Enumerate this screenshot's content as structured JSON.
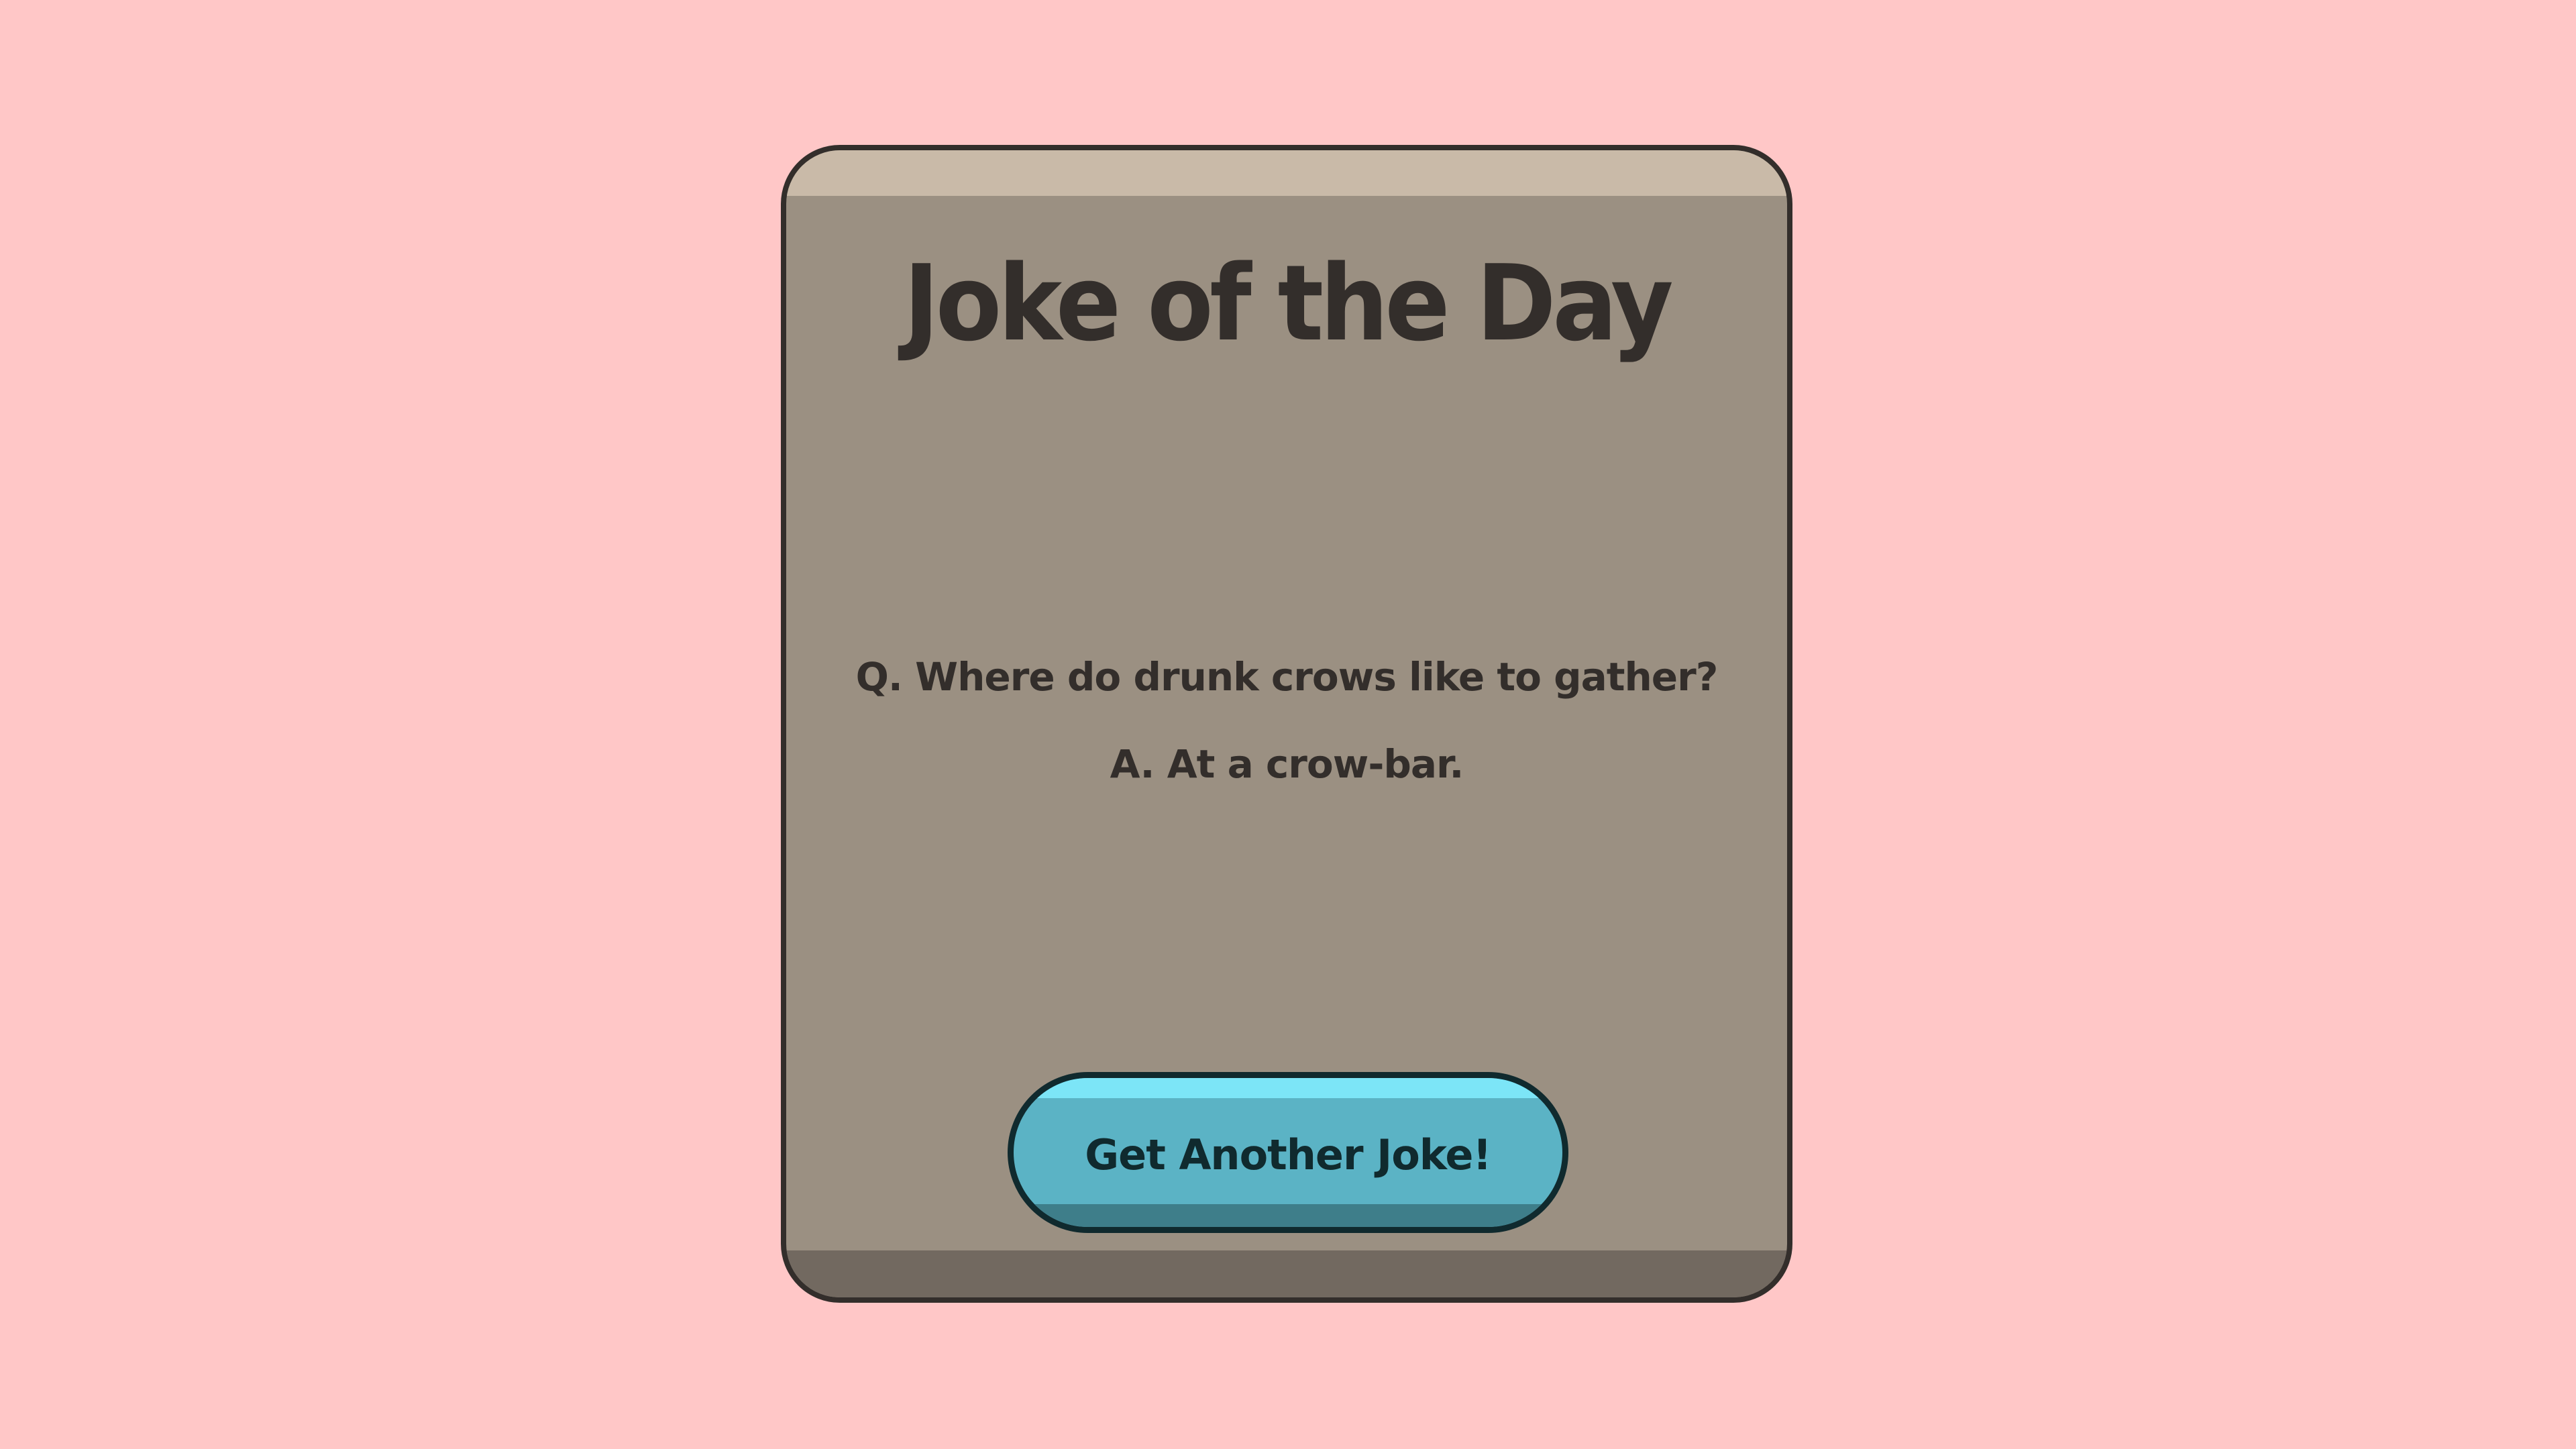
{
  "card": {
    "title": "Joke of the Day",
    "question": "Q. Where do drunk crows like to gather?",
    "answer": "A. At a crow-bar."
  },
  "button": {
    "label": "Get Another Joke!"
  },
  "colors": {
    "background": "#ffc7c7",
    "card": "#9b9082",
    "card_top": "#c9baa8",
    "card_bottom": "#726960",
    "text": "#332e2b",
    "button": "#5bb3c5",
    "button_highlight": "#7ce5f7",
    "button_shadow": "#3e7e8a",
    "button_text": "#102a2e"
  }
}
